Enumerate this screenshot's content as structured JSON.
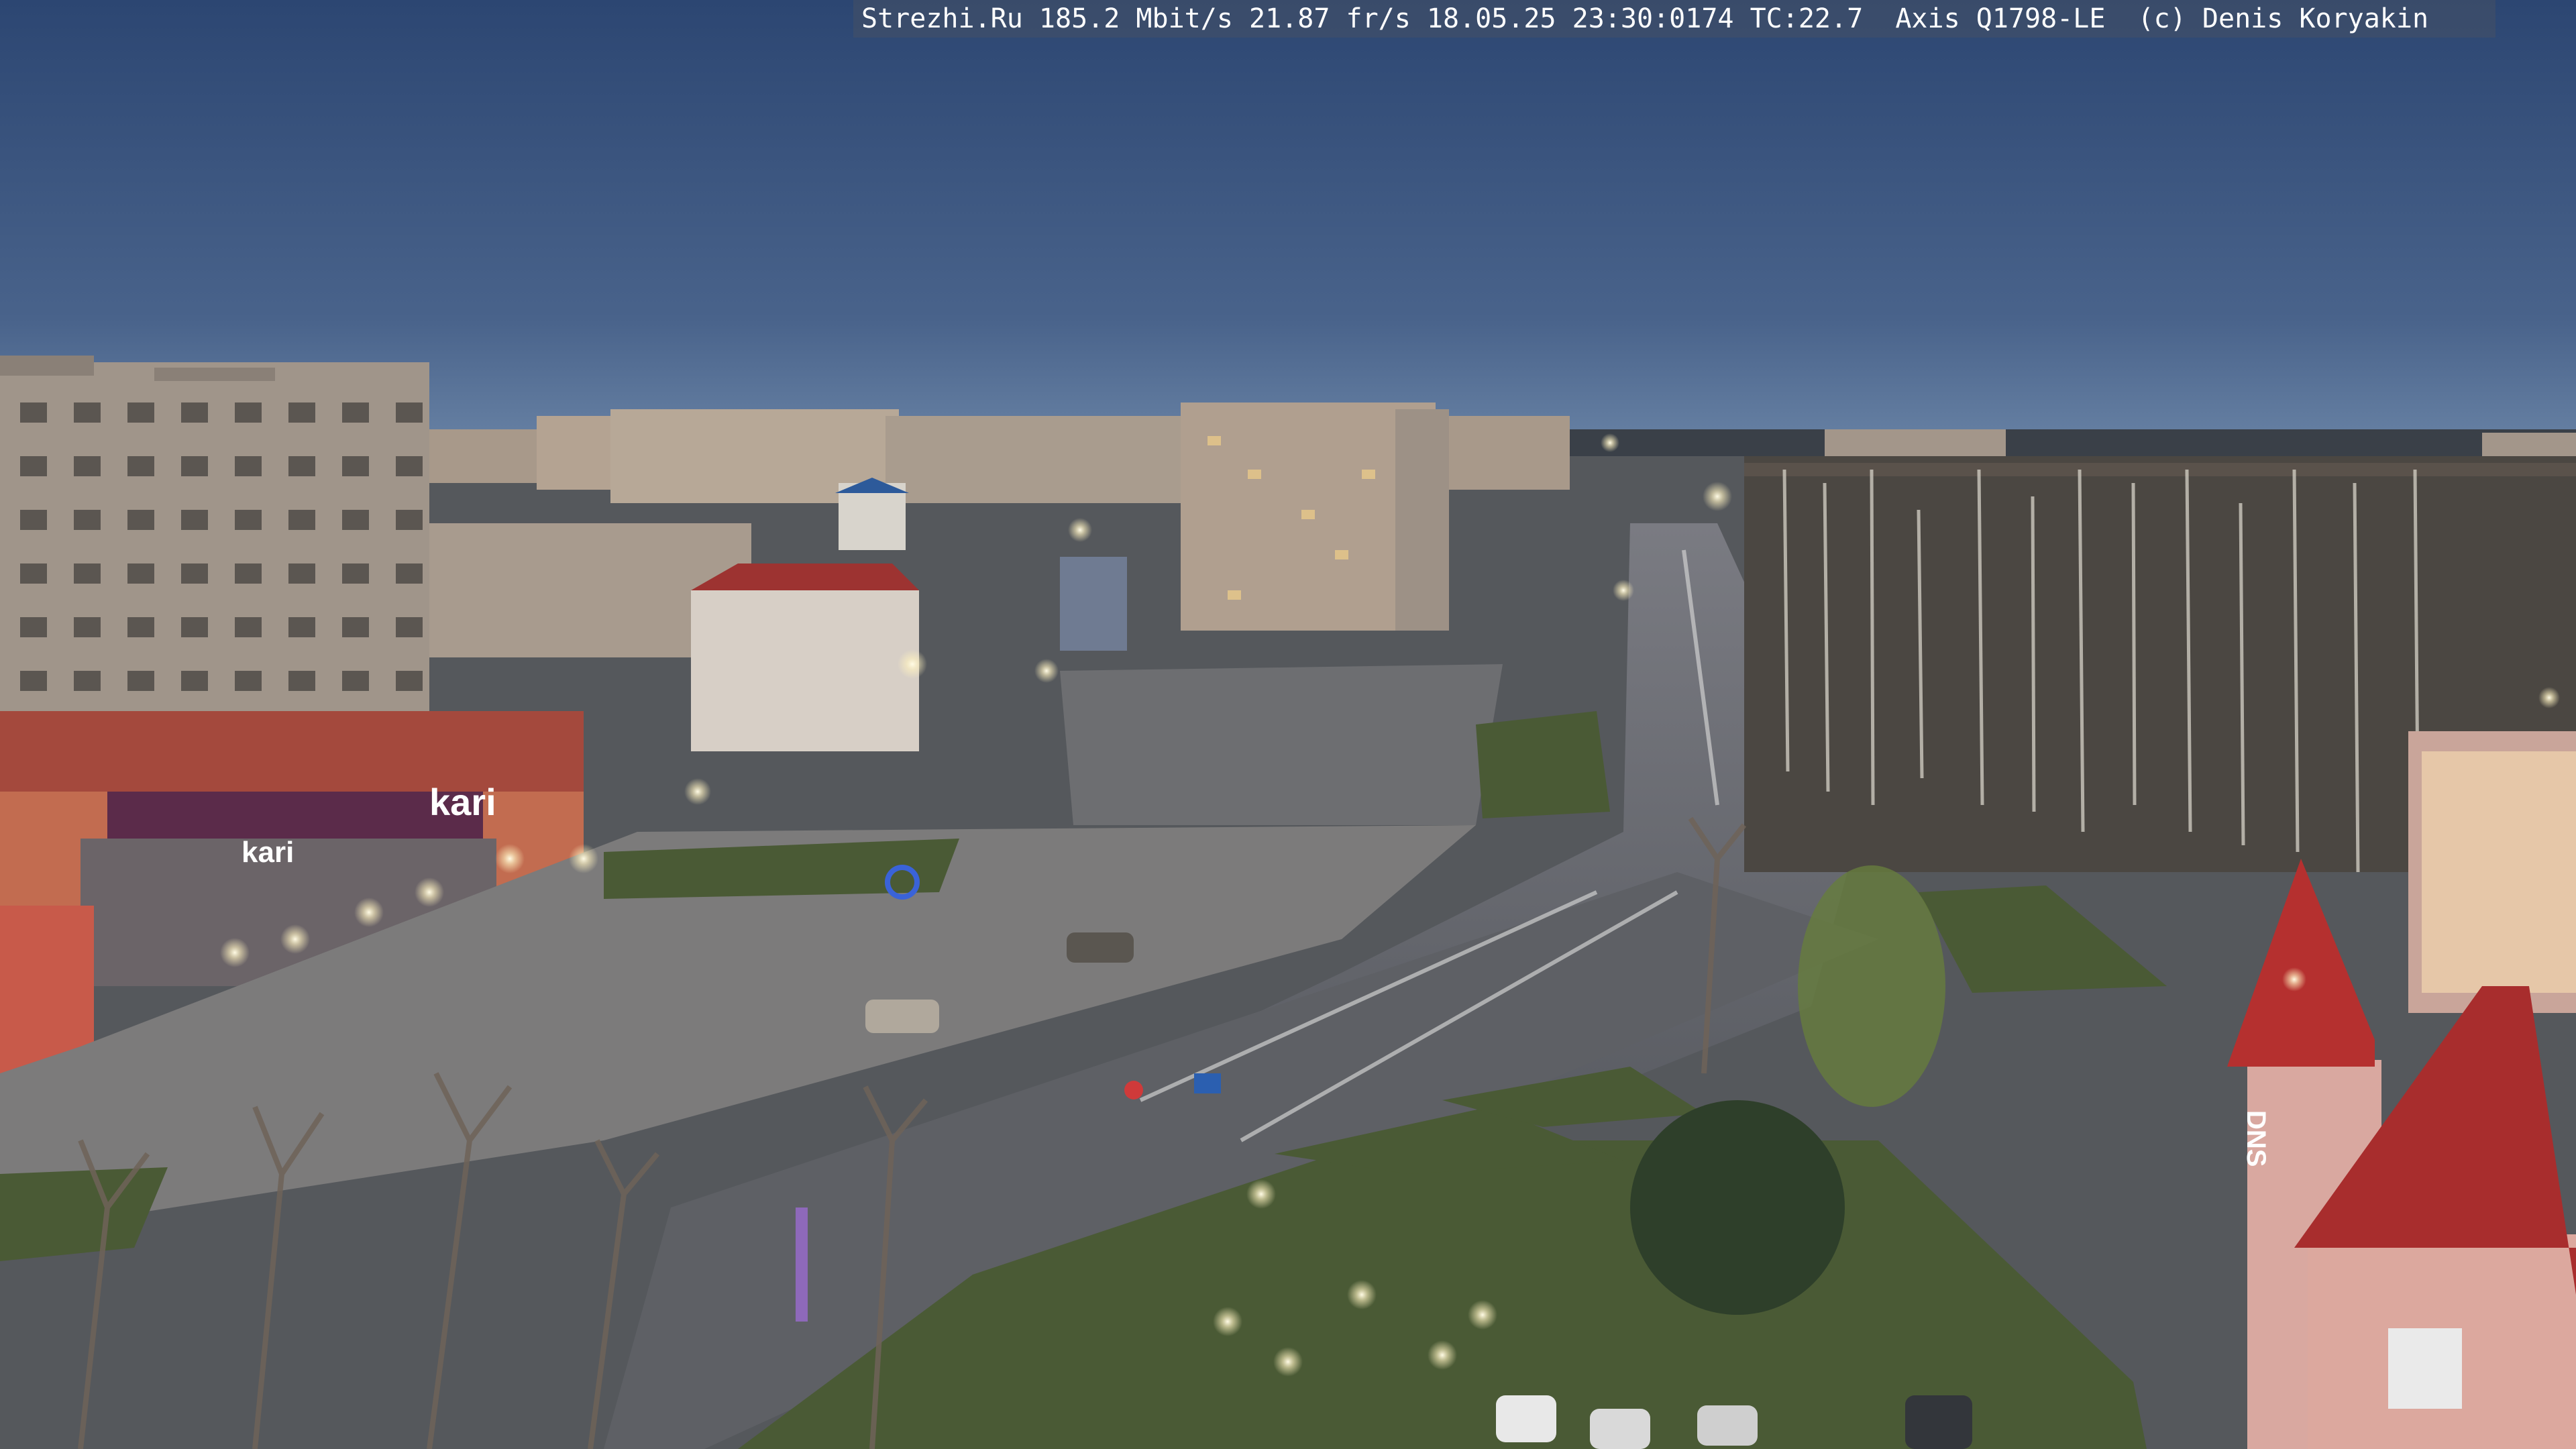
{
  "overlay": {
    "site": "Strezhi.Ru",
    "bitrate": "185.2 Mbit/s",
    "framerate": "21.87 fr/s",
    "datetime": "18.05.25 23:30:0174",
    "tc": "TC:22.7",
    "camera": "Axis Q1798-LE",
    "credit": "(c) Denis Koryakin"
  },
  "signs": {
    "shop_left": "kari",
    "shop_left_small": "kari",
    "store_right": "DNS"
  },
  "colors": {
    "sky_top": "#2f4a76",
    "sky_horizon": "#5e7aa0",
    "road": "#5c5f66",
    "grass": "#4a5a35",
    "building_panel": "#a89a8c",
    "brick_red": "#a64a40",
    "roof_red": "#b5302f",
    "lamp": "#fff6d8"
  }
}
